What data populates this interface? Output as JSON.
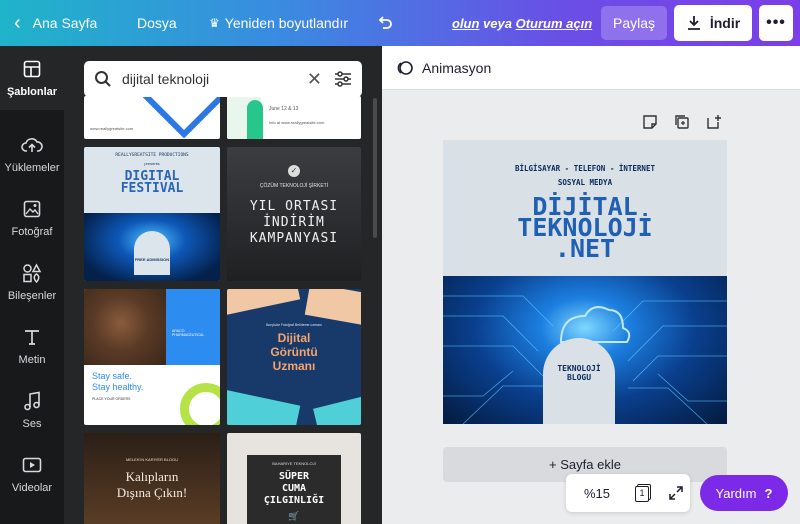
{
  "topbar": {
    "home_label": "Ana Sayfa",
    "file_label": "Dosya",
    "resize_label": "Yeniden boyutlandır",
    "login_part1": "olun",
    "login_part2": " veya ",
    "login_part3": "Oturum açın",
    "share_label": "Paylaş",
    "download_label": "İndir"
  },
  "rail": {
    "items": [
      {
        "label": "Şablonlar",
        "icon": "templates-icon"
      },
      {
        "label": "Yüklemeler",
        "icon": "upload-cloud-icon"
      },
      {
        "label": "Fotoğraf",
        "icon": "photo-icon"
      },
      {
        "label": "Bileşenler",
        "icon": "elements-icon"
      },
      {
        "label": "Metin",
        "icon": "text-icon"
      },
      {
        "label": "Ses",
        "icon": "music-note-icon"
      },
      {
        "label": "Videolar",
        "icon": "video-icon"
      }
    ]
  },
  "search": {
    "value": "dijital teknoloji"
  },
  "templates": {
    "t1_line1": "www.reallygreatsite.com",
    "t2_line1": "June 12 & 13",
    "t2_line2": "Info at www.reallygreatsite.com",
    "t3_small": "REALLYGREATSITE PRODUCTIONS",
    "t3_presents": "presents",
    "t3_title1": "DIGITAL",
    "t3_title2": "FESTIVAL",
    "t3_badge": "FREE ADMISSION",
    "t4_company": "ÇÖZÜM TEKNOLOJİ ŞİRKETİ",
    "t4_title1": "YIL ORTASI",
    "t4_title2": "İNDİRİM",
    "t4_title3": "KAMPANYASI",
    "t5_brand": "ARACO PHARMACEUTICAL",
    "t5_line1": "Stay safe.",
    "t5_line2": "Stay healthy.",
    "t5_small": "PLACE YOUR ORDERS",
    "t6_small": "Borçlular Fotoğraf Belirleme uzmanı",
    "t6_title1": "Dijital",
    "t6_title2": "Görüntü",
    "t6_title3": "Uzmanı",
    "t7_small": "MELEK'IN KARIYER BLOGU",
    "t7_title1": "Kalıpların",
    "t7_title2": "Dışına Çıkın!",
    "t8_small": "BAHARIYE TEKNOLOJİ",
    "t8_title1": "SÜPER",
    "t8_title2": "CUMA",
    "t8_title3": "ÇILGINLIĞI"
  },
  "editor": {
    "animation_label": "Animasyon",
    "design": {
      "line1": "BİLGİSAYAR - TELEFON - İNTERNET",
      "line2": "SOSYAL MEDYA",
      "title1": "DİJİTAL",
      "title2": "TEKNOLOJİ",
      "title3": ".NET",
      "badge1": "TEKNOLOJİ",
      "badge2": "BLOGU"
    },
    "add_page_label": "+ Sayfa ekle",
    "zoom": "%15",
    "page_count": "1",
    "help_label": "Yardım",
    "help_icon": "?"
  },
  "colors": {
    "accent": "#7d2ae8",
    "rail_bg": "#18191b",
    "panel_bg": "#252627",
    "design_title": "#0b2a5c"
  }
}
